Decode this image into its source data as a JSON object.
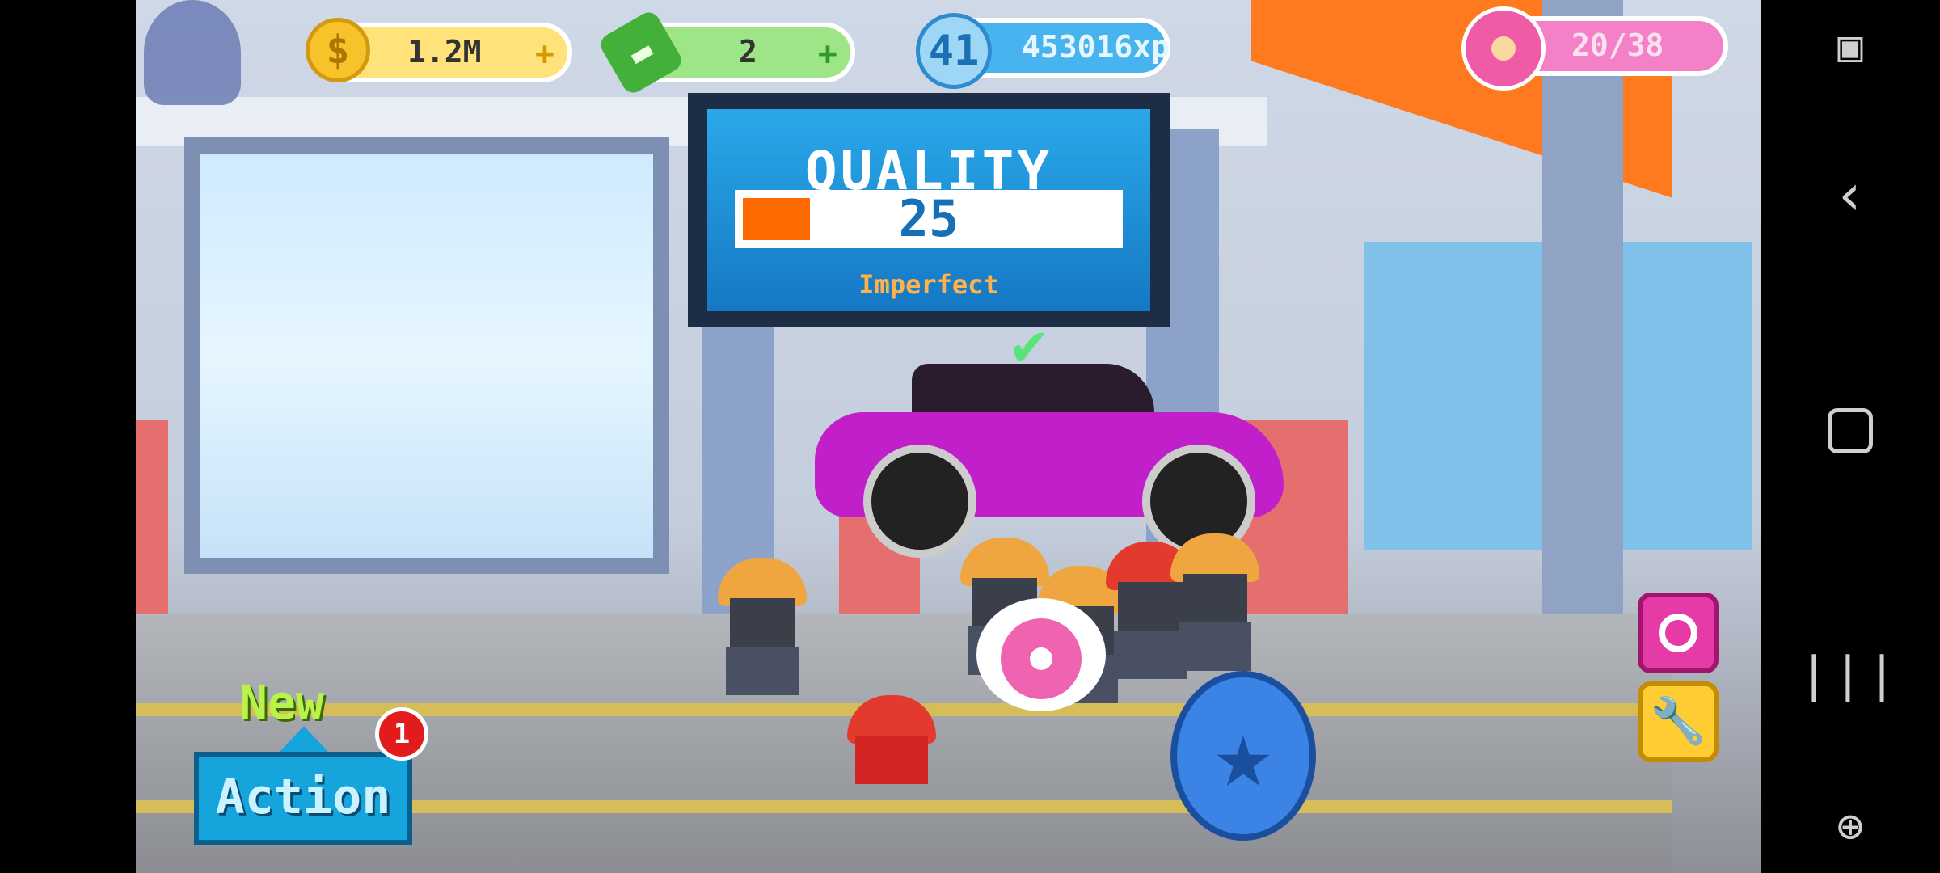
{
  "hud": {
    "coins": "1.2M",
    "coin_symbol": "$",
    "cash": "2",
    "level": "41",
    "xp": "453016xp",
    "donuts": "20/38",
    "plus": "+"
  },
  "quality_panel": {
    "title": "QUALITY",
    "value": "25",
    "fill_fraction": 0.18,
    "label": "Imperfect"
  },
  "action": {
    "new_label": "New",
    "button_label": "Action",
    "notification_count": "1"
  },
  "colors": {
    "quality_fill": "#ff6a00",
    "action_button": "#15a5dc",
    "donut_pink": "#f063b0",
    "car": "#c11fc9"
  },
  "icons": {
    "coin": "coin-icon",
    "cash": "cash-icon",
    "donut": "donut-icon",
    "wrench": "wrench-icon",
    "star": "star-icon"
  }
}
